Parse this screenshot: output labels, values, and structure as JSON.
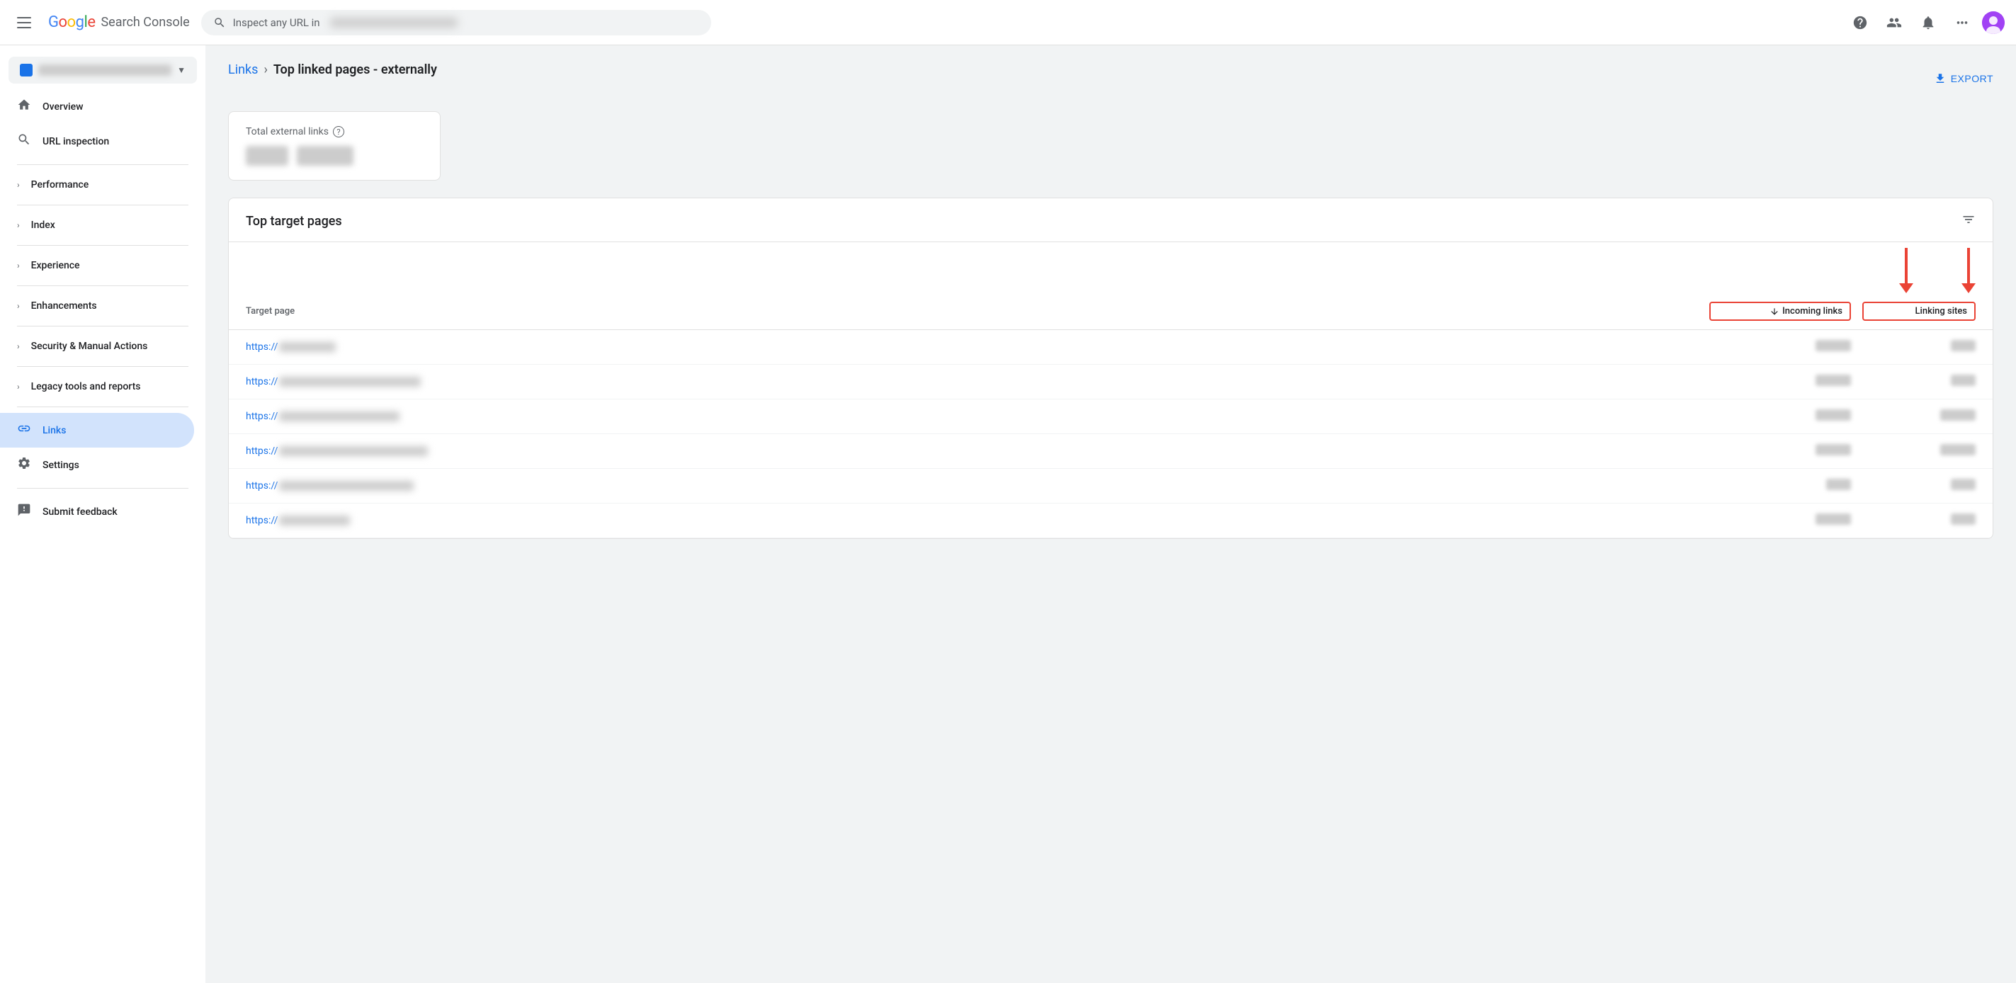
{
  "header": {
    "menu_label": "Menu",
    "logo_text": "Google",
    "app_title": "Search Console",
    "search_placeholder": "Inspect any URL in",
    "help_icon": "help-circle-icon",
    "account_icon": "account-icon",
    "notifications_icon": "notifications-icon",
    "apps_icon": "apps-icon"
  },
  "sidebar": {
    "property_name": "example.com",
    "items": [
      {
        "id": "overview",
        "label": "Overview",
        "icon": "home"
      },
      {
        "id": "url-inspection",
        "label": "URL inspection",
        "icon": "search"
      }
    ],
    "sections": [
      {
        "id": "performance",
        "label": "Performance"
      },
      {
        "id": "index",
        "label": "Index"
      },
      {
        "id": "experience",
        "label": "Experience"
      },
      {
        "id": "enhancements",
        "label": "Enhancements"
      },
      {
        "id": "security",
        "label": "Security & Manual Actions"
      },
      {
        "id": "legacy",
        "label": "Legacy tools and reports"
      }
    ],
    "bottom_items": [
      {
        "id": "links",
        "label": "Links",
        "icon": "links"
      },
      {
        "id": "settings",
        "label": "Settings",
        "icon": "settings"
      },
      {
        "id": "submit-feedback",
        "label": "Submit feedback",
        "icon": "feedback"
      }
    ]
  },
  "breadcrumb": {
    "parent": "Links",
    "current": "Top linked pages - externally"
  },
  "export": {
    "label": "EXPORT"
  },
  "stats_card": {
    "title": "Total external links",
    "help_label": "?"
  },
  "table": {
    "title": "Top target pages",
    "columns": {
      "target_page": "Target page",
      "incoming_links": "Incoming links",
      "linking_sites": "Linking sites"
    },
    "rows": [
      {
        "url": "https://",
        "url_extra": "blurred1",
        "incoming": "blurred",
        "linking": "blurred"
      },
      {
        "url": "https://",
        "url_extra": "blurred2",
        "incoming": "blurred",
        "linking": "blurred"
      },
      {
        "url": "https://",
        "url_extra": "blurred3",
        "incoming": "blurred",
        "linking": "blurred"
      },
      {
        "url": "https://",
        "url_extra": "blurred4",
        "incoming": "blurred",
        "linking": "blurred"
      },
      {
        "url": "https://",
        "url_extra": "blurred5",
        "incoming": "blurred",
        "linking": "blurred"
      },
      {
        "url": "https://",
        "url_extra": "blurred6",
        "incoming": "blurred",
        "linking": "blurred"
      }
    ],
    "filter_icon": "filter-icon"
  }
}
